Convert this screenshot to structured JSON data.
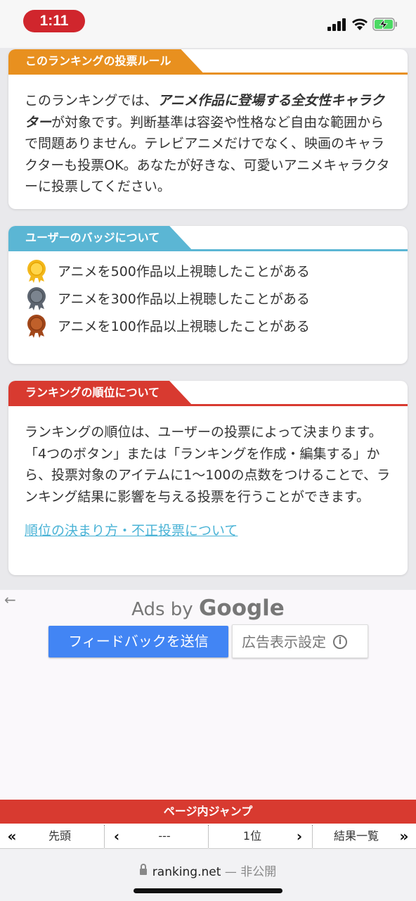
{
  "status": {
    "time": "1:11"
  },
  "vote_rules": {
    "title": "このランキングの投票ルール",
    "color": "#e8901f",
    "text_before": "このランキングでは、",
    "text_bold": "アニメ作品に登場する全女性キャラクター",
    "text_after": "が対象です。判断基準は容姿や性格など自由な範囲からで問題ありません。テレビアニメだけでなく、映画のキャラクターも投票OK。あなたが好きな、可愛いアニメキャラクターに投票してください。"
  },
  "badges": {
    "title": "ユーザーのバッジについて",
    "color": "#5bb6d4",
    "items": [
      {
        "label": "アニメを500作品以上視聴したことがある",
        "icon": "gold-badge-icon",
        "color": "#f3b81c"
      },
      {
        "label": "アニメを300作品以上視聴したことがある",
        "icon": "silver-badge-icon",
        "color": "#5d6570"
      },
      {
        "label": "アニメを100作品以上視聴したことがある",
        "icon": "bronze-badge-icon",
        "color": "#a2471a"
      }
    ]
  },
  "ranking_order": {
    "title": "ランキングの順位について",
    "color": "#d83a30",
    "text": "ランキングの順位は、ユーザーの投票によって決まります。「4つのボタン」または「ランキングを作成・編集する」から、投票対象のアイテムに1〜100の点数をつけることで、ランキング結果に影響を与える投票を行うことができます。",
    "link": "順位の決まり方・不正投票について"
  },
  "ads": {
    "back_icon": "back-arrow-icon",
    "ads_by": "Ads by",
    "google": "Google",
    "feedback_button": "フィードバックを送信",
    "settings_button": "広告表示設定",
    "info_icon": "i"
  },
  "jump": {
    "title": "ページ内ジャンプ",
    "first_icon": "«",
    "first": "先頭",
    "prev_icon": "‹",
    "prev": "---",
    "next": "1位",
    "next_icon": "›",
    "results": "結果一覧",
    "last_icon": "»"
  },
  "url_bar": {
    "domain": "ranking.net",
    "separator": "—",
    "status": "非公開"
  }
}
